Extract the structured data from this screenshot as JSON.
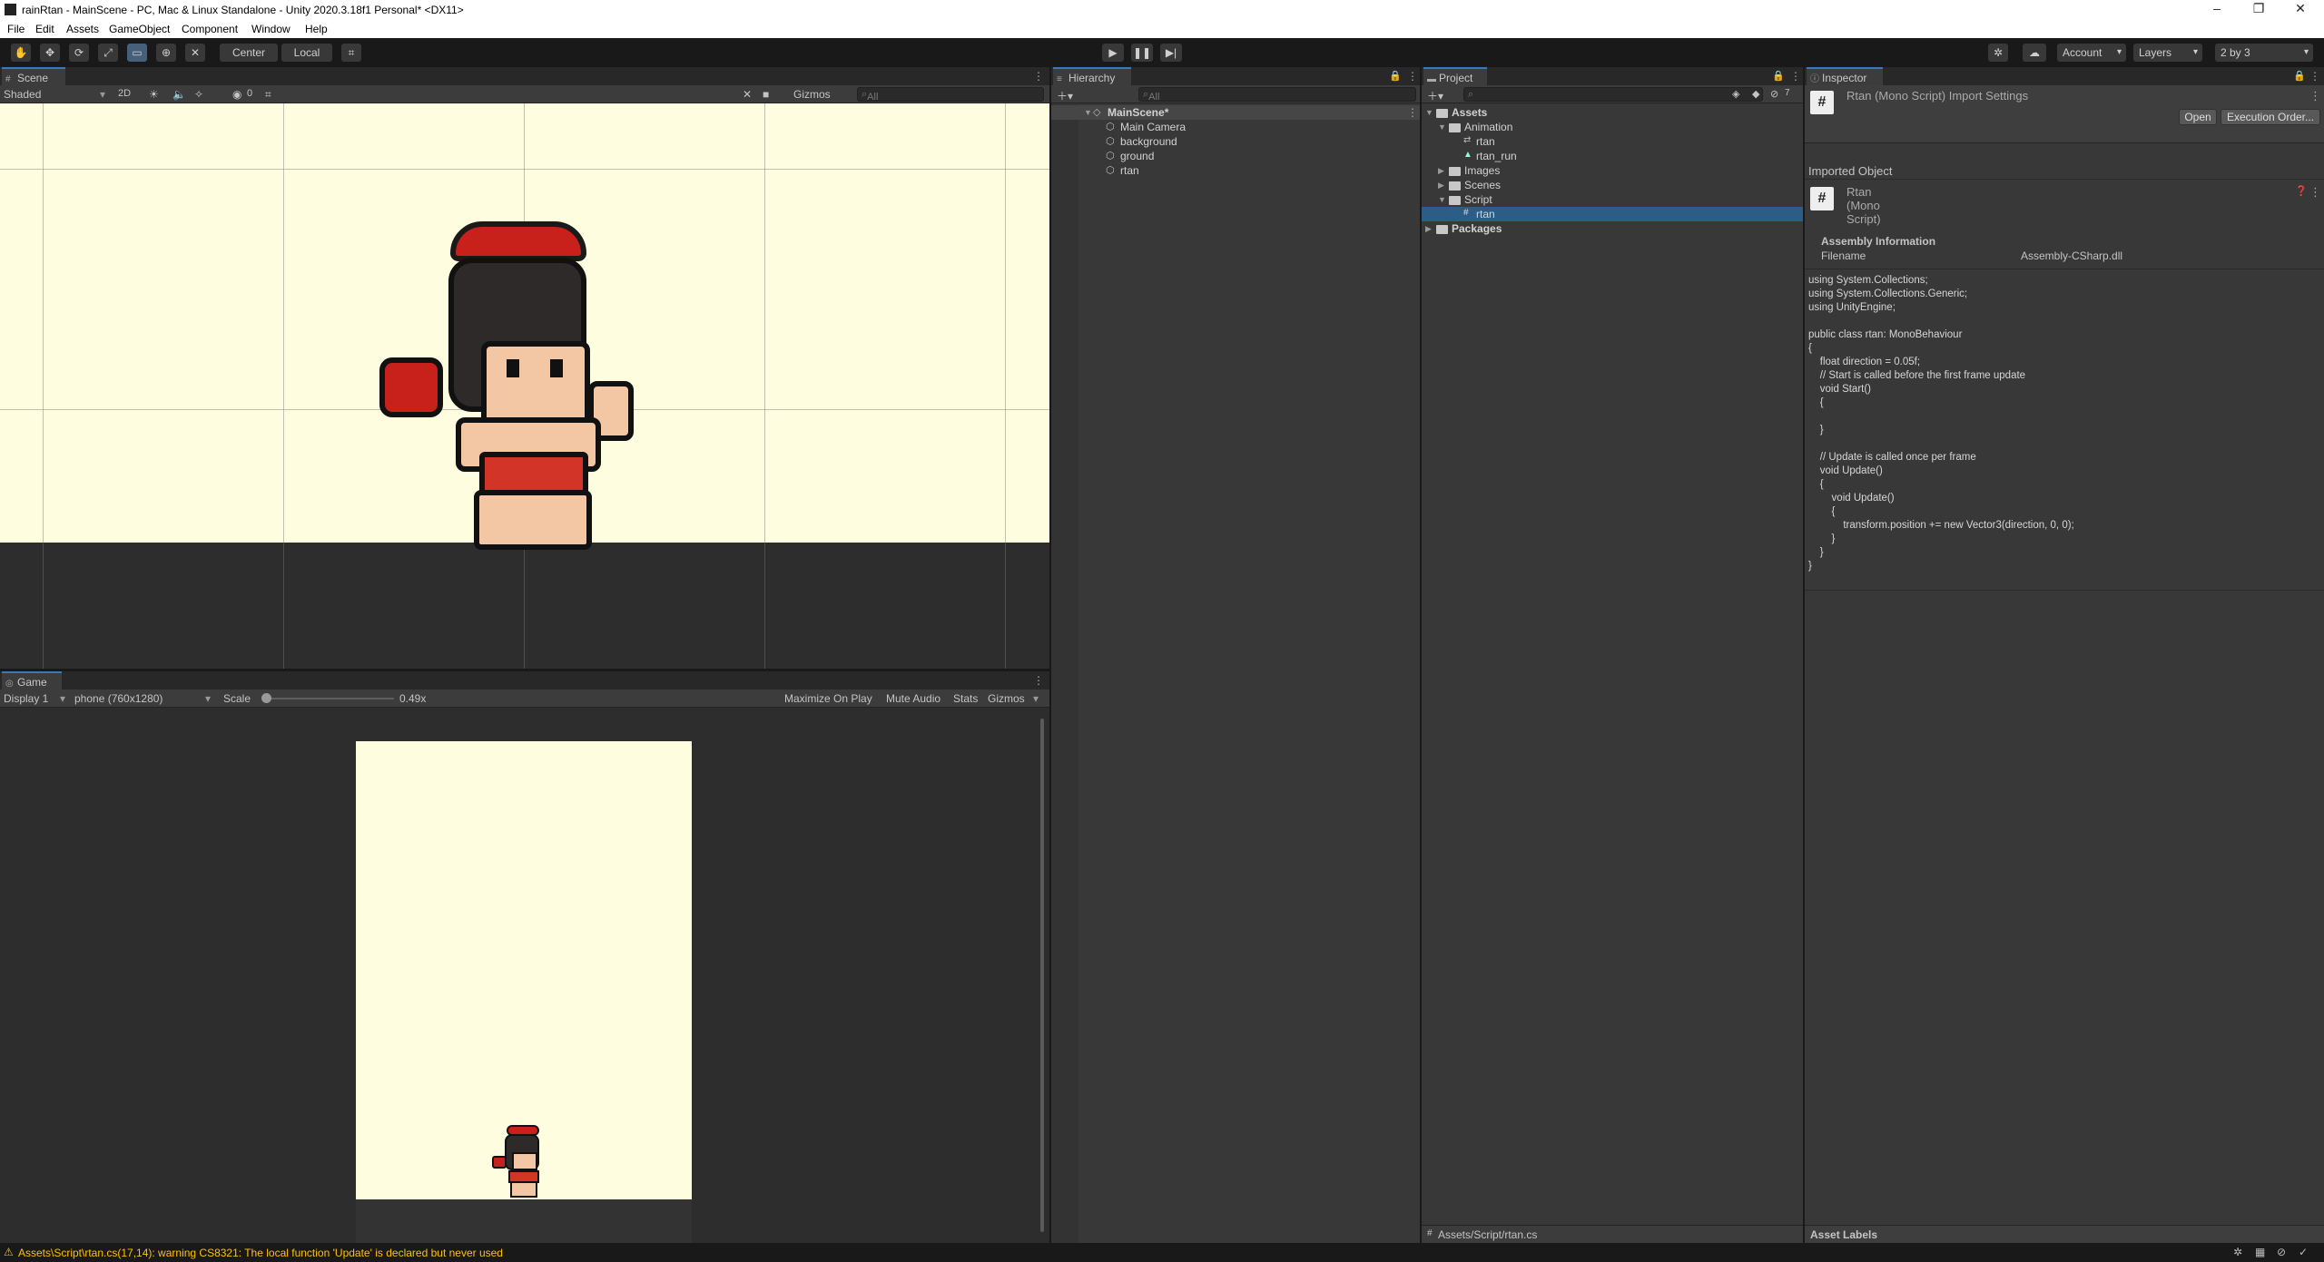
{
  "window": {
    "title": "rainRtan - MainScene - PC, Mac & Linux Standalone - Unity 2020.3.18f1 Personal* <DX11>",
    "controls": [
      "–",
      "❐",
      "✕"
    ]
  },
  "menu": [
    "File",
    "Edit",
    "Assets",
    "GameObject",
    "Component",
    "Window",
    "Help"
  ],
  "toolbar": {
    "pivot": "Center",
    "space": "Local",
    "account": "Account",
    "layers": "Layers",
    "layout": "2 by 3"
  },
  "scene": {
    "tab": "Scene",
    "shading": "Shaded",
    "mode2d": "2D",
    "hidden_count": "0",
    "gizmos": "Gizmos",
    "search": "All"
  },
  "game": {
    "tab": "Game",
    "display": "Display 1",
    "resolution": "phone (760x1280)",
    "scale_label": "Scale",
    "scale_value": "0.49x",
    "maximize": "Maximize On Play",
    "mute": "Mute Audio",
    "stats": "Stats",
    "gizmos": "Gizmos"
  },
  "hierarchy": {
    "tab": "Hierarchy",
    "search": "All",
    "scene_name": "MainScene*",
    "items": [
      "Main Camera",
      "background",
      "ground",
      "rtan"
    ]
  },
  "project": {
    "tab": "Project",
    "hidden_count": "7",
    "assets": "Assets",
    "animation": "Animation",
    "anim_items": [
      "rtan",
      "rtan_run"
    ],
    "images": "Images",
    "scenes": "Scenes",
    "script": "Script",
    "script_item": "rtan",
    "packages": "Packages",
    "footer_path": "Assets/Script/rtan.cs"
  },
  "inspector": {
    "tab": "Inspector",
    "header_title": "Rtan (Mono Script) Import Settings",
    "open": "Open",
    "execution_order": "Execution Order...",
    "imported_object": "Imported Object",
    "object_title": "Rtan (Mono Script)",
    "assembly_info": "Assembly Information",
    "filename_label": "Filename",
    "filename_value": "Assembly-CSharp.dll",
    "code": "using System.Collections;\nusing System.Collections.Generic;\nusing UnityEngine;\n\npublic class rtan: MonoBehaviour\n{\n    float direction = 0.05f;\n    // Start is called before the first frame update\n    void Start()\n    {\n\n    }\n\n    // Update is called once per frame\n    void Update()\n    {\n        void Update()\n        {\n            transform.position += new Vector3(direction, 0, 0);\n        }\n    }\n}",
    "asset_labels": "Asset Labels"
  },
  "status": {
    "message": "Assets\\Script\\rtan.cs(17,14): warning CS8321: The local function 'Update' is declared but never used"
  },
  "colors": {
    "editor_bg": "#383838",
    "scene_bg": "#fffde0",
    "selection": "#2c5d87",
    "warning": "#ffc107"
  }
}
